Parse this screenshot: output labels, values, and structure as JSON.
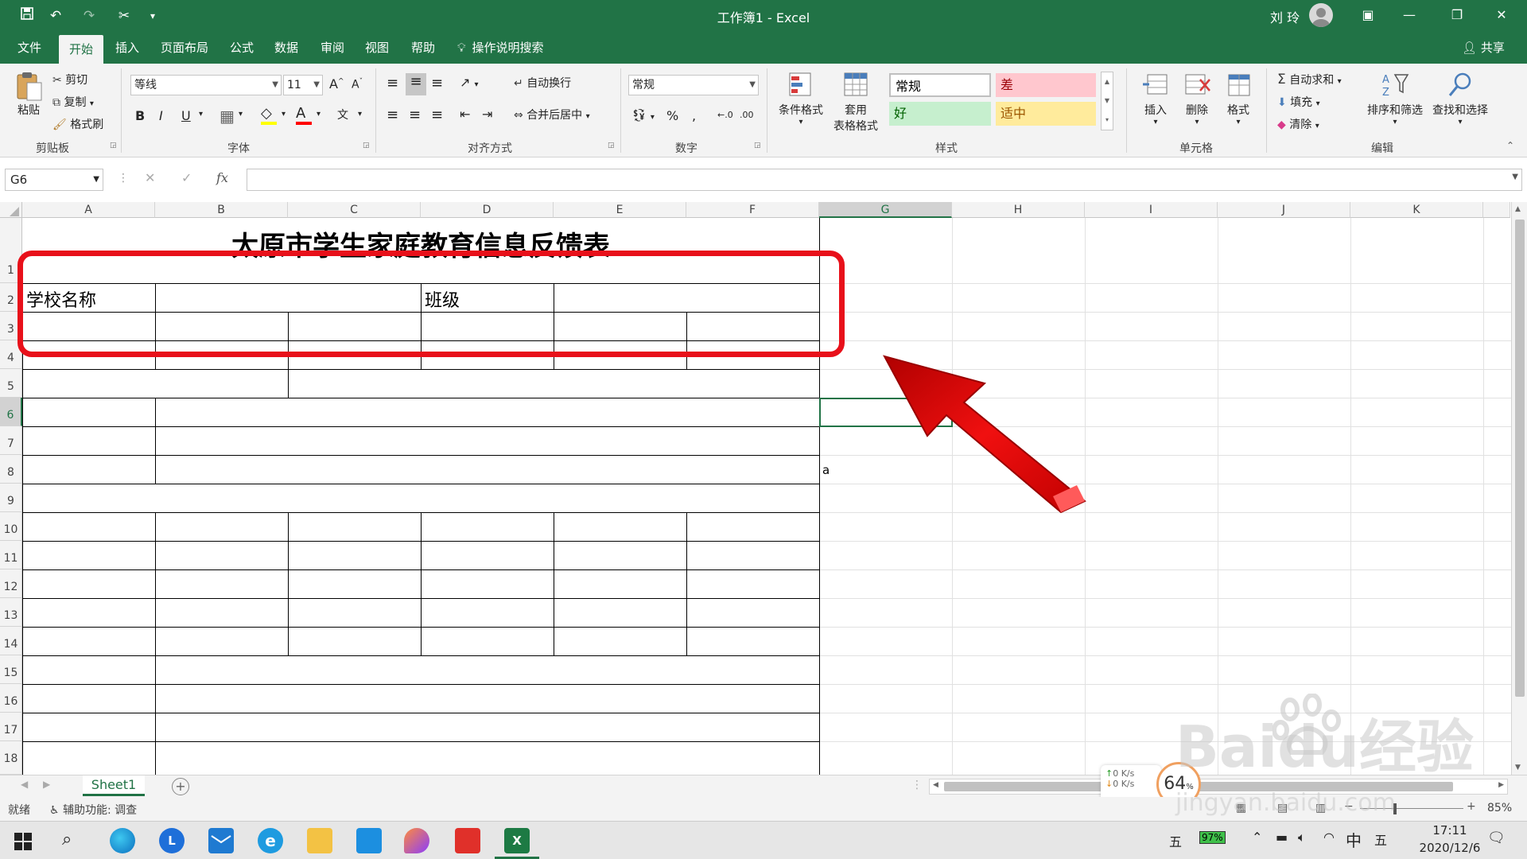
{
  "window": {
    "title": "工作簿1  -  Excel",
    "user": "刘 玲"
  },
  "quick_access": {
    "save": "save-icon",
    "undo": "undo-icon",
    "redo": "redo-icon",
    "cut": "scissors-icon"
  },
  "tabs": [
    {
      "label": "文件"
    },
    {
      "label": "开始"
    },
    {
      "label": "插入"
    },
    {
      "label": "页面布局"
    },
    {
      "label": "公式"
    },
    {
      "label": "数据"
    },
    {
      "label": "审阅"
    },
    {
      "label": "视图"
    },
    {
      "label": "帮助"
    }
  ],
  "tell_me": "操作说明搜索",
  "share": "共享",
  "ribbon": {
    "clipboard": {
      "paste": "粘贴",
      "cut": "剪切",
      "copy": "复制",
      "format_painter": "格式刷",
      "label": "剪贴板"
    },
    "font": {
      "name": "等线",
      "size": "11",
      "label": "字体"
    },
    "alignment": {
      "wrap": "自动换行",
      "merge": "合并后居中",
      "label": "对齐方式"
    },
    "number": {
      "format": "常规",
      "label": "数字"
    },
    "styles": {
      "conditional": "条件格式",
      "table_1": "套用",
      "table_2": "表格格式",
      "normal": "常规",
      "bad": "差",
      "good": "好",
      "neutral": "适中",
      "label": "样式"
    },
    "cells": {
      "insert": "插入",
      "delete": "删除",
      "format": "格式",
      "label": "单元格"
    },
    "editing": {
      "autosum": "自动求和",
      "fill": "填充",
      "clear": "清除",
      "sort": "排序和筛选",
      "find": "查找和选择",
      "label": "编辑"
    }
  },
  "formula_bar": {
    "name_box": "G6",
    "fx": "fx",
    "content": ""
  },
  "columns": [
    "A",
    "B",
    "C",
    "D",
    "E",
    "F",
    "G",
    "H",
    "I",
    "J",
    "K"
  ],
  "rows": [
    "1",
    "2",
    "3",
    "4",
    "5",
    "6",
    "7",
    "8",
    "9",
    "10",
    "11",
    "12",
    "13",
    "14",
    "15",
    "16",
    "17",
    "18"
  ],
  "cells": {
    "title": "太原市学生家庭教育信息反馈表",
    "a2": "学校名称",
    "d2": "班级",
    "g8": "a"
  },
  "sheet_tab": "Sheet1",
  "status": {
    "ready": "就绪",
    "accessibility": "辅助功能: 调查",
    "zoom": "85%"
  },
  "net": {
    "up": "0 K/s",
    "down": "0 K/s",
    "speed": "64"
  },
  "watermark": {
    "brand": "Baidu经验",
    "url": "jingyan.baidu.com"
  },
  "taskbar": {
    "ime_1": "五",
    "battery": "97%",
    "ime_2": "中",
    "ime_3": "五",
    "time": "17:11",
    "date": "2020/12/6"
  },
  "colors": {
    "excel_green": "#217346",
    "highlight_red": "#e8101a"
  }
}
